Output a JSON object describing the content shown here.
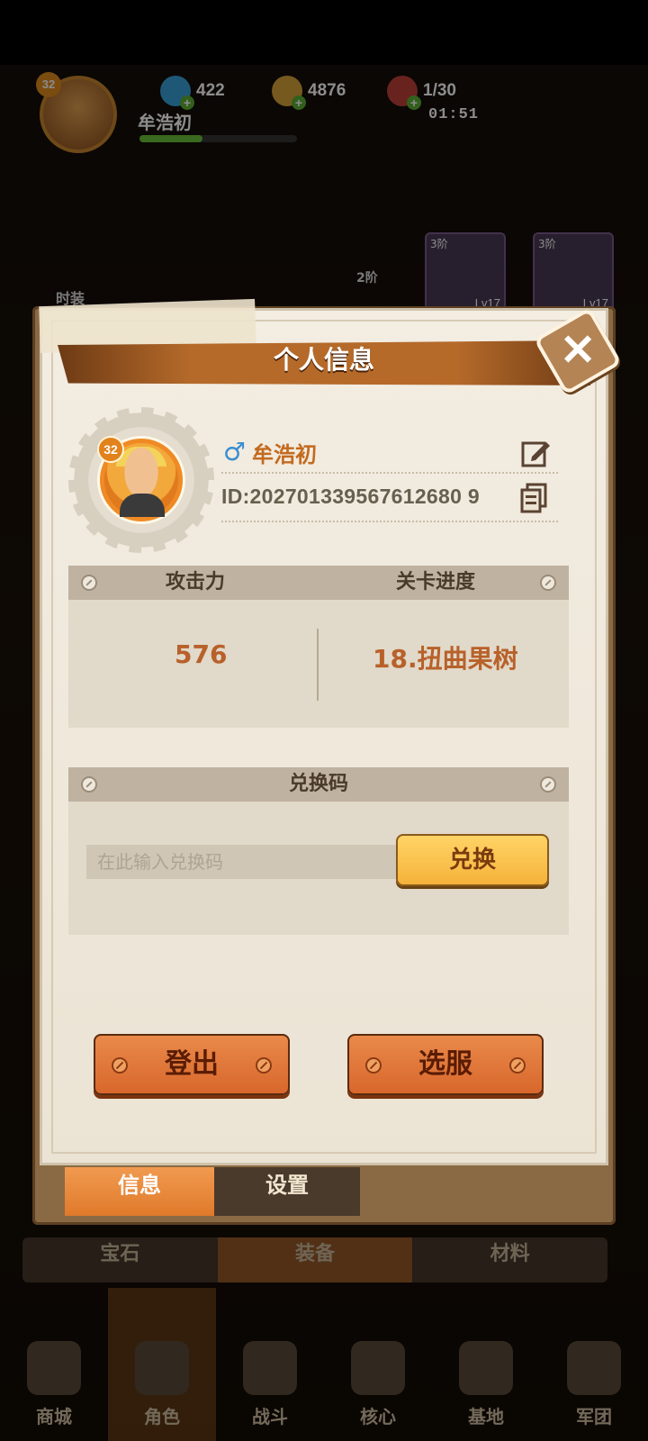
{
  "hud": {
    "level": "32",
    "player_name": "牟浩初",
    "gems": "422",
    "coins": "4876",
    "stamina": "1/30",
    "timer": "01:51"
  },
  "background_cards": [
    {
      "tier": "3阶",
      "level": "Lv17"
    },
    {
      "tier": "3阶",
      "level": "Lv17"
    }
  ],
  "background_labels": {
    "fashion": "时装",
    "tier_badge": "2阶"
  },
  "modal": {
    "title": "个人信息",
    "close_icon": "close-x-icon"
  },
  "profile": {
    "level": "32",
    "gender_symbol": "♂",
    "name": "牟浩初",
    "id_text": "ID:202701339567612680 9"
  },
  "stats": {
    "attack_label": "攻击力",
    "progress_label": "关卡进度",
    "attack_value": "576",
    "progress_value": "18.扭曲果树"
  },
  "redeem": {
    "header": "兑换码",
    "placeholder": "在此输入兑换码",
    "button_label": "兑换"
  },
  "actions": {
    "logout": "登出",
    "select_server": "选服"
  },
  "tabs": {
    "info": "信息",
    "settings": "设置"
  },
  "bg_tabs": [
    "宝石",
    "装备",
    "材料"
  ],
  "bottom_nav": [
    "商城",
    "角色",
    "战斗",
    "核心",
    "基地",
    "军团"
  ],
  "colors": {
    "accent_orange": "#e07a2a",
    "gold_button": "#f5b23a",
    "paper": "#f3ede2",
    "gender_blue": "#3a8ed0"
  }
}
